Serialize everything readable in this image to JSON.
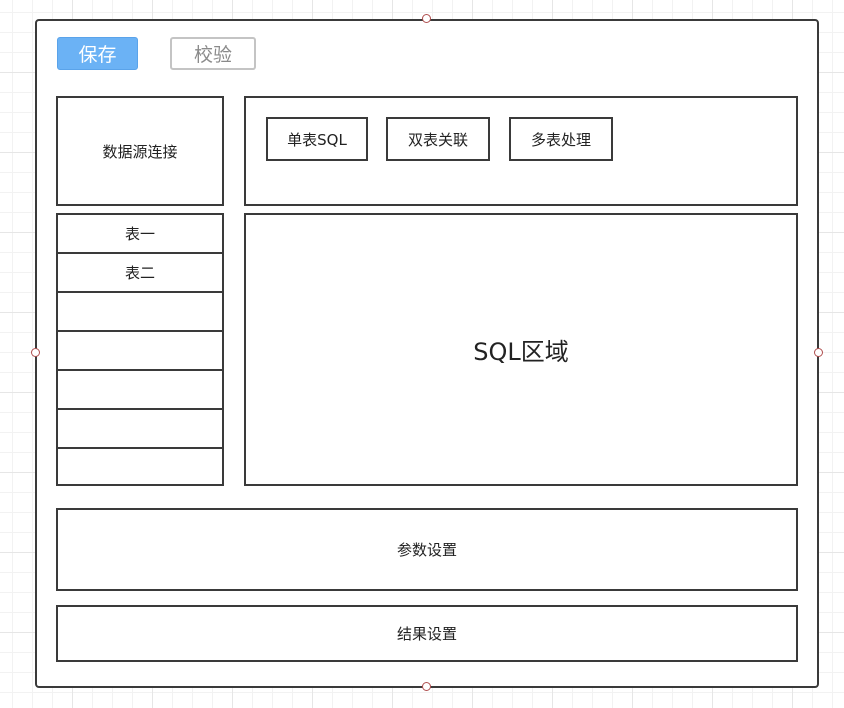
{
  "toolbar": {
    "save_label": "保存",
    "validate_label": "校验"
  },
  "datasource": {
    "label": "数据源连接"
  },
  "sql_tabs": [
    {
      "label": "单表SQL"
    },
    {
      "label": "双表关联"
    },
    {
      "label": "多表处理"
    }
  ],
  "tables": [
    {
      "label": "表一"
    },
    {
      "label": "表二"
    },
    {
      "label": ""
    },
    {
      "label": ""
    },
    {
      "label": ""
    },
    {
      "label": ""
    },
    {
      "label": ""
    }
  ],
  "sql_area": {
    "label": "SQL区域"
  },
  "params": {
    "label": "参数设置"
  },
  "results": {
    "label": "结果设置"
  },
  "colors": {
    "save_button": "#6bb2f5",
    "border": "#3a3a3a",
    "handle": "#b05050"
  }
}
